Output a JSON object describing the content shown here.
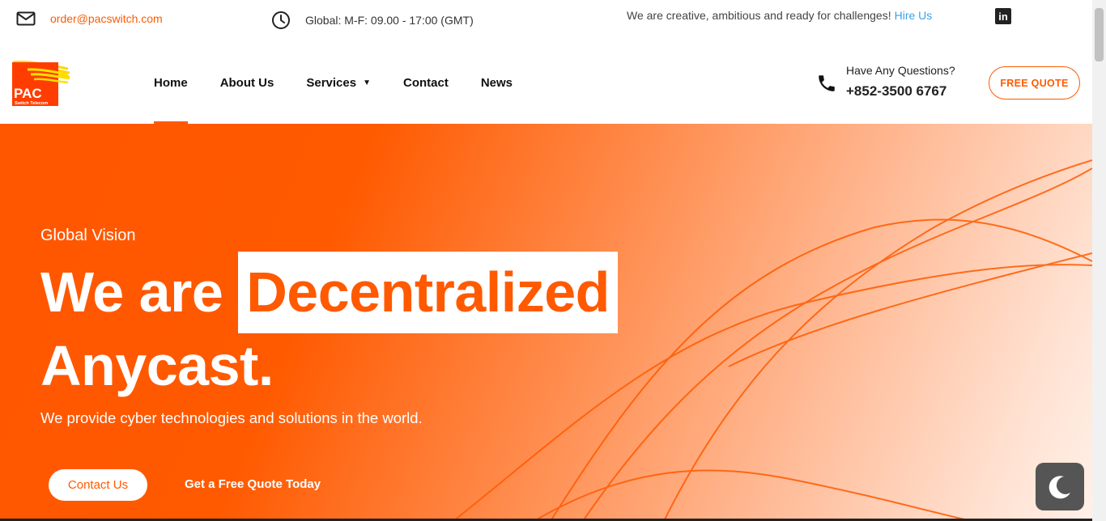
{
  "topbar": {
    "email": "order@pacswitch.com",
    "hours": "Global: M-F: 09.00 - 17:00 (GMT)",
    "tagline": "We are creative, ambitious and ready for challenges!",
    "hire_link": "Hire Us",
    "social_icon": "linkedin-icon"
  },
  "logo": {
    "main": "PAC",
    "sub": "Switch Telecom"
  },
  "nav": {
    "items": [
      {
        "label": "Home",
        "active": true
      },
      {
        "label": "About Us"
      },
      {
        "label": "Services",
        "caret": "▼"
      },
      {
        "label": "Contact"
      },
      {
        "label": "News"
      }
    ]
  },
  "contact": {
    "question": "Have Any Questions?",
    "phone": "+852-3500 6767",
    "quote_button": "FREE QUOTE"
  },
  "hero": {
    "kicker": "Global Vision",
    "headline_part1": "We are",
    "headline_highlight": "Decentralized",
    "headline_part2": "Anycast.",
    "subtitle": "We provide cyber technologies and solutions in the world.",
    "cta_primary": "Contact Us",
    "cta_secondary": "Get a Free Quote Today"
  },
  "colors": {
    "accent": "#ff5a00",
    "link": "#3aa0e8",
    "dark": "#222222"
  }
}
